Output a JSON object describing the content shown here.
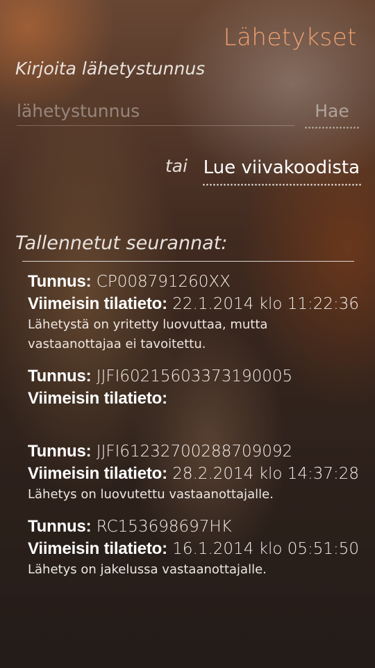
{
  "header": {
    "title": "Lähetykset"
  },
  "search": {
    "section_label": "Kirjoita lähetystunnus",
    "placeholder": "lähetystunnus",
    "value": "",
    "button_label": "Hae"
  },
  "barcode": {
    "or_label": "tai",
    "button_label": "Lue viivakoodista"
  },
  "saved": {
    "header": "Tallennetut seurannat:",
    "id_label": "Tunnus:",
    "status_label": "Viimeisin tilatieto:",
    "items": [
      {
        "id": "CP008791260XX",
        "timestamp": "22.1.2014 klo 11:22:36",
        "description": "Lähetystä on yritetty luovuttaa, mutta vastaanottajaa ei tavoitettu."
      },
      {
        "id": "JJFI60215603373190005",
        "timestamp": "",
        "description": ""
      },
      {
        "id": "JJFI61232700288709092",
        "timestamp": "28.2.2014 klo 14:37:28",
        "description": "Lähetys on luovutettu vastaanottajalle."
      },
      {
        "id": "RC153698697HK",
        "timestamp": "16.1.2014 klo 05:51:50",
        "description": "Lähetys on jakelussa vastaanottajalle."
      }
    ]
  },
  "colors": {
    "accent": "#f0a071",
    "text": "#ffffff"
  }
}
